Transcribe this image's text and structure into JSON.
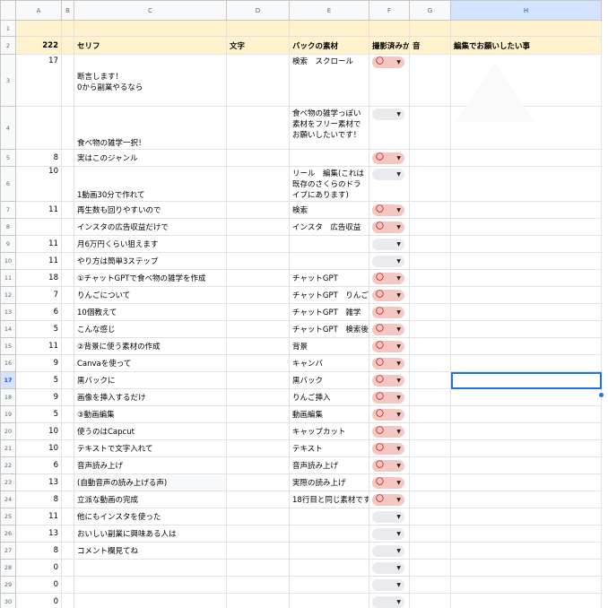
{
  "columns": [
    "A",
    "B",
    "C",
    "D",
    "E",
    "F",
    "G",
    "H"
  ],
  "selected_column": "H",
  "selected_row": "17",
  "dropdown_mark": "〇",
  "header_row": {
    "A": "222",
    "C": "セリフ",
    "D": "文字",
    "E": "バックの素材",
    "F": "撮影済みか",
    "G": "音",
    "H": "編集でお願いしたい事"
  },
  "rows": [
    {
      "num": "1"
    },
    {
      "num": "3",
      "A": "17",
      "C": "断言します！\n0から副業やるなら",
      "E": "検索　スクロール",
      "F": "〇"
    },
    {
      "num": "4",
      "C": "食べ物の雑学一択！",
      "E": "食べ物の雑学っぽい素材をフリー素材でお願いしたいです！",
      "F": ""
    },
    {
      "num": "5",
      "A": "8",
      "C": "実はこのジャンル",
      "F": "〇"
    },
    {
      "num": "6",
      "A": "10",
      "C": "1動画30分で作れて",
      "E": "リール　編集(これは既存のさくらのドライブにあります)",
      "F": ""
    },
    {
      "num": "7",
      "A": "11",
      "C": "再生数も回りやすいので",
      "E": "検索",
      "F": "〇"
    },
    {
      "num": "8",
      "C": "インスタの広告収益だけで",
      "E": "インスタ　広告収益",
      "F": "〇"
    },
    {
      "num": "9",
      "A": "11",
      "C": "月6万円くらい狙えます",
      "F": ""
    },
    {
      "num": "10",
      "A": "11",
      "C": "やり方は簡単3ステップ",
      "F": ""
    },
    {
      "num": "11",
      "A": "18",
      "C": "①チャットGPTで食べ物の雑学を作成",
      "E": "チャットGPT",
      "F": "〇"
    },
    {
      "num": "12",
      "A": "7",
      "C": "りんごについて",
      "E": "チャットGPT　りんご",
      "F": "〇"
    },
    {
      "num": "13",
      "A": "6",
      "C": "10個教えて",
      "E": "チャットGPT　雑学",
      "F": "〇"
    },
    {
      "num": "14",
      "A": "5",
      "C": "こんな感じ",
      "E": "チャットGPT　検索後",
      "F": "〇"
    },
    {
      "num": "15",
      "A": "11",
      "C": "②背景に使う素材の作成",
      "E": "背景",
      "F": "〇"
    },
    {
      "num": "16",
      "A": "9",
      "C": "Canvaを使って",
      "E": "キャンバ",
      "F": "〇"
    },
    {
      "num": "17",
      "A": "5",
      "C": "黒バックに",
      "E": "黒バック",
      "F": "〇"
    },
    {
      "num": "18",
      "A": "9",
      "C": "画像を挿入するだけ",
      "E": "りんご挿入",
      "F": "〇"
    },
    {
      "num": "19",
      "A": "5",
      "C": "③動画編集",
      "E": "動画編集",
      "F": "〇"
    },
    {
      "num": "20",
      "A": "10",
      "C": "使うのはCapcut",
      "E": "キャップカット",
      "F": "〇"
    },
    {
      "num": "21",
      "A": "10",
      "C": "テキストで文字入れて",
      "E": "テキスト",
      "F": "〇"
    },
    {
      "num": "22",
      "A": "6",
      "C": "音声読み上げ",
      "E": "音声読み上げ",
      "F": "〇"
    },
    {
      "num": "23",
      "A": "13",
      "C": "(自動音声の読み上げる声)",
      "E": "実際の読み上げ",
      "F": "〇"
    },
    {
      "num": "24",
      "A": "8",
      "C": "立派な動画の完成",
      "E": "18行目と同じ素材です",
      "F": "〇"
    },
    {
      "num": "25",
      "A": "11",
      "C": "他にもインスタを使った",
      "F": ""
    },
    {
      "num": "26",
      "A": "13",
      "C": "おいしい副業に興味ある人は",
      "F": ""
    },
    {
      "num": "27",
      "A": "8",
      "C": "コメント欄見てね",
      "F": ""
    },
    {
      "num": "28",
      "A": "0",
      "F": ""
    },
    {
      "num": "29",
      "A": "0",
      "F": ""
    },
    {
      "num": "30",
      "A": "0",
      "F": ""
    }
  ]
}
